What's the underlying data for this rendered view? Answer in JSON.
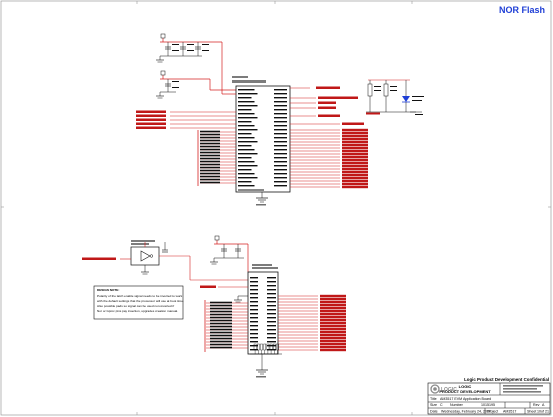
{
  "sheet_title": "NOR Flash",
  "title_block": {
    "confidential": "Logic Product Development Confidential",
    "company_logo": "LOGIC",
    "company": "LOGIC",
    "division": "PRODUCT DEVELOPMENT",
    "title_key": "Title",
    "title_value": "AM3517 EVM Application Board",
    "size_key": "Size",
    "size_value": "C",
    "number_key": "Number",
    "number_value": "1015195",
    "rev_key": "Rev",
    "rev_value": "A",
    "date_key": "Date",
    "date_value": "Wednesday, February 24, 2010",
    "project_key": "Project",
    "project_value": "AM3517",
    "sheet_key": "Sheet",
    "sheet_value": "10",
    "of_key": "of",
    "of_value": "21"
  },
  "note_box": {
    "heading": "DESIGN NOTE:",
    "lines": [
      "Polarity of the latch enable signal needs to be inverted to work",
      "with the default settings that the processor will use at boot time.",
      "Also possible pads so signal can be used non-inverted if",
      "Nor or Gpmc pins pay insertion, upgrades creation manual."
    ]
  },
  "colors": {
    "title_blue": "#1f3fd6",
    "wire_red": "#d42020",
    "net_red": "#c01818",
    "pin_black": "#111111",
    "border_gray": "#9a9a9a"
  },
  "icons": {
    "logo": "logic-logo-mark",
    "ground": "ground-symbol",
    "power": "power-rail-symbol",
    "led": "led-symbol"
  }
}
